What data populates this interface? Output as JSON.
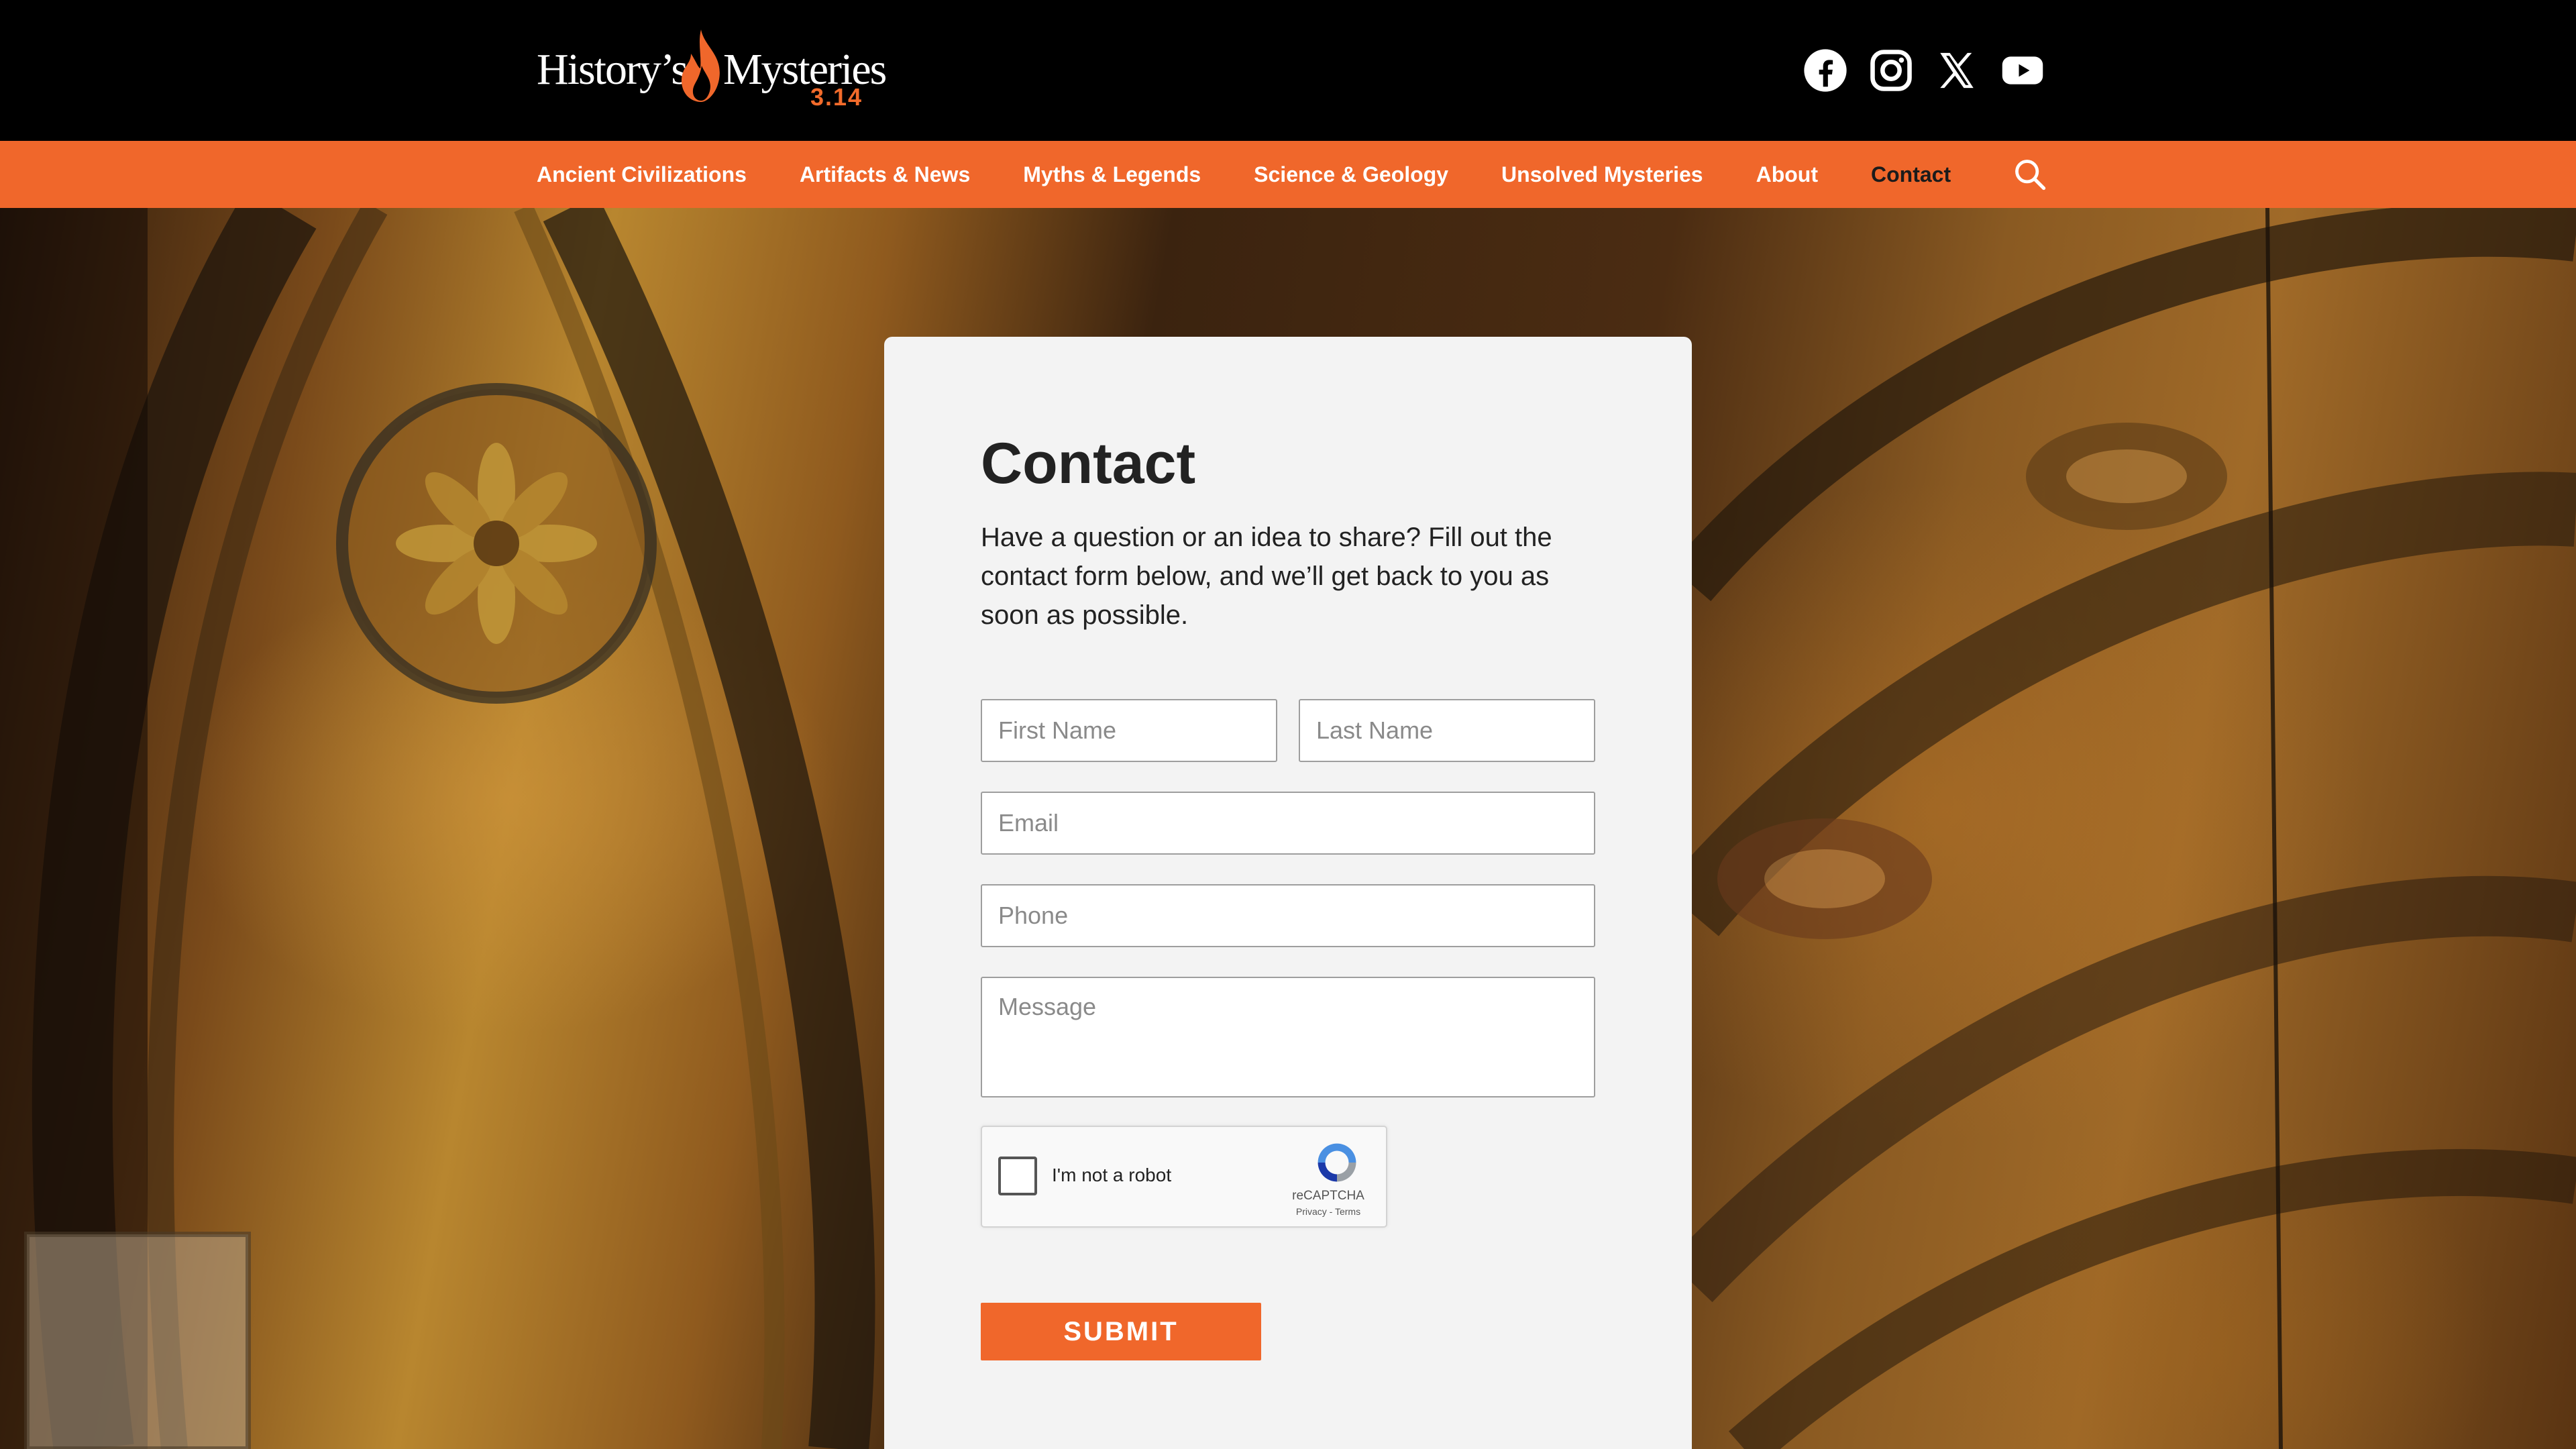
{
  "header": {
    "logo": {
      "text_left": "History’s",
      "text_right": "Mysteries",
      "version": "3.14"
    },
    "social": [
      {
        "icon": "facebook-icon"
      },
      {
        "icon": "instagram-icon"
      },
      {
        "icon": "x-twitter-icon"
      },
      {
        "icon": "youtube-icon"
      }
    ]
  },
  "nav": {
    "items": [
      {
        "label": "Ancient Civilizations"
      },
      {
        "label": "Artifacts & News"
      },
      {
        "label": "Myths & Legends"
      },
      {
        "label": "Science & Geology"
      },
      {
        "label": "Unsolved Mysteries"
      },
      {
        "label": "About"
      },
      {
        "label": "Contact",
        "active": true
      }
    ],
    "search_icon": "search-icon"
  },
  "contact": {
    "title": "Contact",
    "intro": "Have a question or an idea to share? Fill out the contact form below, and we’ll get back to you as soon as possible.",
    "first_name_placeholder": "First Name",
    "last_name_placeholder": "Last Name",
    "email_placeholder": "Email",
    "phone_placeholder": "Phone",
    "message_placeholder": "Message",
    "captcha": {
      "label": "I'm not a robot",
      "brand": "reCAPTCHA",
      "links": "Privacy - Terms"
    },
    "submit_label": "SUBMIT"
  },
  "colors": {
    "accent": "#f0672b",
    "topbar": "#000000",
    "card": "#f3f3f3"
  }
}
